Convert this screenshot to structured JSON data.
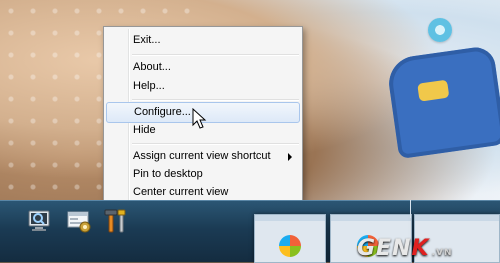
{
  "context_menu": {
    "items": [
      {
        "label": "Exit..."
      },
      {
        "label": "About..."
      },
      {
        "label": "Help..."
      },
      {
        "label": "Configure..."
      },
      {
        "label": "Hide"
      },
      {
        "label": "Assign current view shortcut"
      },
      {
        "label": "Pin to desktop"
      },
      {
        "label": "Center current view"
      }
    ],
    "hovered_item": "Configure..."
  },
  "taskbar": {
    "icons": [
      "magnifier-monitor-icon",
      "settings-window-icon",
      "tools-icon"
    ]
  },
  "watermark": {
    "brand_main": "GEN",
    "brand_accent": "K",
    "brand_suffix": ".VN"
  },
  "colors": {
    "menu_bg": "#f5f5f5",
    "hover_border": "#a9c6ec",
    "taskbar": "#1b3b54"
  }
}
